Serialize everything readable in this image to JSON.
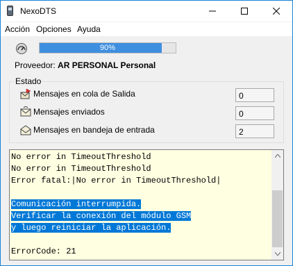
{
  "window": {
    "title": "NexoDTS"
  },
  "menu": {
    "items": [
      "Acción",
      "Opciones",
      "Ayuda"
    ]
  },
  "progress": {
    "value_percent": 90,
    "label": "90%"
  },
  "provider": {
    "label": "Proveedor:",
    "value": "AR PERSONAL Personal"
  },
  "status": {
    "group_label": "Estado",
    "rows": [
      {
        "icon": "outbox-icon",
        "label": "Mensajes en cola de Salida",
        "value": "0"
      },
      {
        "icon": "sent-mail-icon",
        "label": "Mensajes enviados",
        "value": "0"
      },
      {
        "icon": "inbox-mail-icon",
        "label": "Mensajes en bandeja de entrada",
        "value": "2"
      }
    ]
  },
  "log": {
    "lines": [
      "No error in TimeoutThreshold",
      "No error in TimeoutThreshold",
      "Error fatal:|No error in TimeoutThreshold|",
      "",
      "Comunicación interrumpida.",
      "Verificar la conexión del módulo GSM",
      "y luego reiniciar la aplicación.",
      "",
      "ErrorCode: 21"
    ],
    "selected_line_indexes": [
      4,
      5,
      6
    ]
  },
  "colors": {
    "selection": "#0078d7",
    "log_background": "#ffffe1",
    "progress_fill": "#3f8fe0"
  }
}
